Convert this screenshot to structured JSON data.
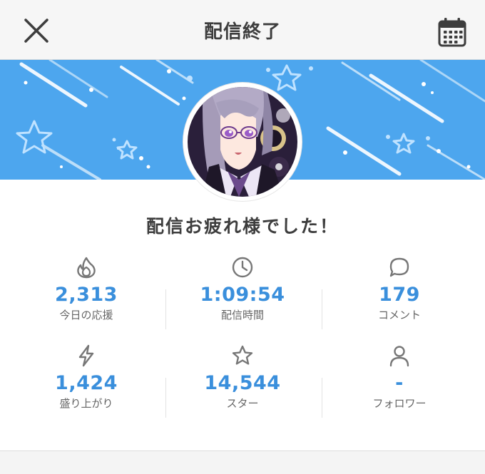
{
  "header": {
    "title": "配信終了",
    "close_icon": "close-icon",
    "calendar_icon": "calendar-icon"
  },
  "message": "配信お疲れ様でした！",
  "stats": [
    {
      "icon": "flame-icon",
      "value": "2,313",
      "label": "今日の応援"
    },
    {
      "icon": "clock-icon",
      "value": "1:09:54",
      "label": "配信時間"
    },
    {
      "icon": "comment-icon",
      "value": "179",
      "label": "コメント"
    },
    {
      "icon": "lightning-icon",
      "value": "1,424",
      "label": "盛り上がり"
    },
    {
      "icon": "star-icon",
      "value": "14,544",
      "label": "スター"
    },
    {
      "icon": "person-icon",
      "value": "-",
      "label": "フォロワー"
    }
  ],
  "colors": {
    "accent": "#3a8fdc",
    "banner": "#4da6ee",
    "header_bg": "#f6f6f6"
  }
}
